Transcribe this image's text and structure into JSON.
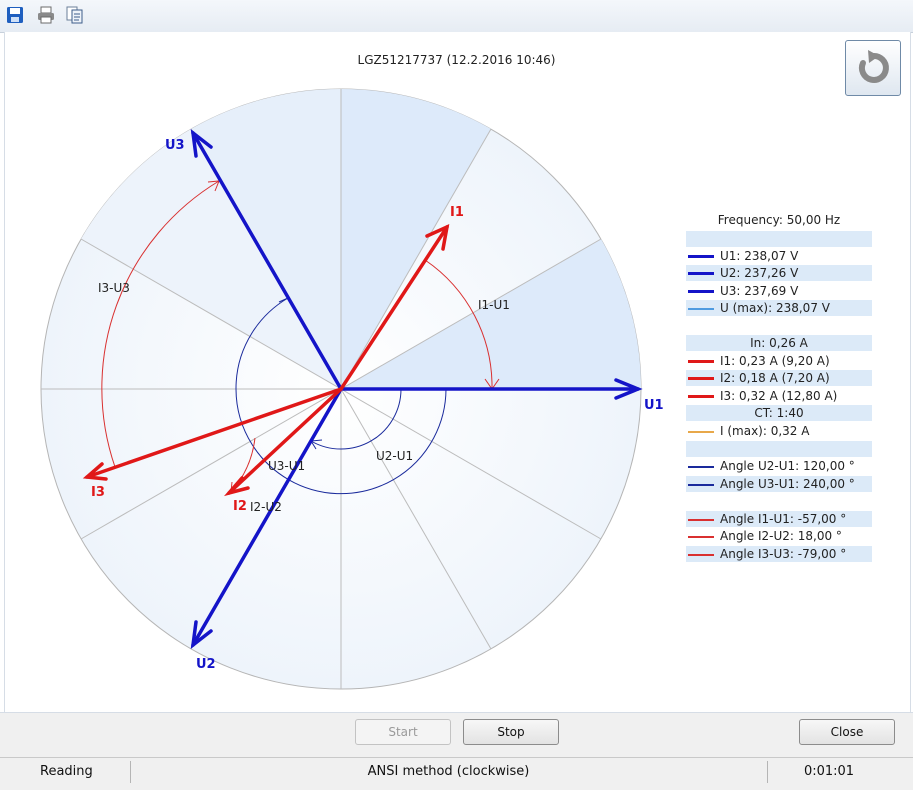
{
  "toolbar": {
    "icons": [
      "save-icon",
      "print-icon",
      "copy-icon"
    ]
  },
  "header": {
    "title": "LGZ51217737 (12.2.2016 10:46)"
  },
  "diagram": {
    "labels": {
      "U1": "U1",
      "U2": "U2",
      "U3": "U3",
      "I1": "I1",
      "I2": "I2",
      "I3": "I3",
      "I1_U1": "I1-U1",
      "I2_U2": "I2-U2",
      "I3_U3": "I3-U3",
      "U2_U1": "U2-U1",
      "U3_U1": "U3-U1"
    },
    "colors": {
      "voltage": "#1414c8",
      "current": "#e01818",
      "arc_voltage": "#1a2a9c",
      "arc_current": "#d93030",
      "grid": "#bcbcbc"
    },
    "phasor_angles_deg": {
      "U1": 0,
      "U2": 120,
      "U3": 240,
      "I1": -57,
      "I2": 18,
      "I3": -79
    }
  },
  "legend": {
    "frequency": "Frequency: 50,00 Hz",
    "u1": "U1: 238,07 V",
    "u2": "U2: 237,26 V",
    "u3": "U3: 237,69 V",
    "umax": "U (max): 238,07 V",
    "in": "In: 0,26 A",
    "i1": "I1: 0,23 A (9,20 A)",
    "i2": "I2: 0,18 A (7,20 A)",
    "i3": "I3: 0,32 A (12,80 A)",
    "ct": "CT: 1:40",
    "imax": "I (max): 0,32 A",
    "angle_u2_u1": "Angle U2-U1: 120,00 °",
    "angle_u3_u1": "Angle U3-U1: 240,00 °",
    "angle_i1_u1": "Angle I1-U1: -57,00 °",
    "angle_i2_u2": "Angle I2-U2: 18,00 °",
    "angle_i3_u3": "Angle I3-U3: -79,00 °"
  },
  "buttons": {
    "start": "Start",
    "stop": "Stop",
    "close": "Close"
  },
  "status": {
    "state": "Reading",
    "method": "ANSI method (clockwise)",
    "elapsed": "0:01:01"
  }
}
